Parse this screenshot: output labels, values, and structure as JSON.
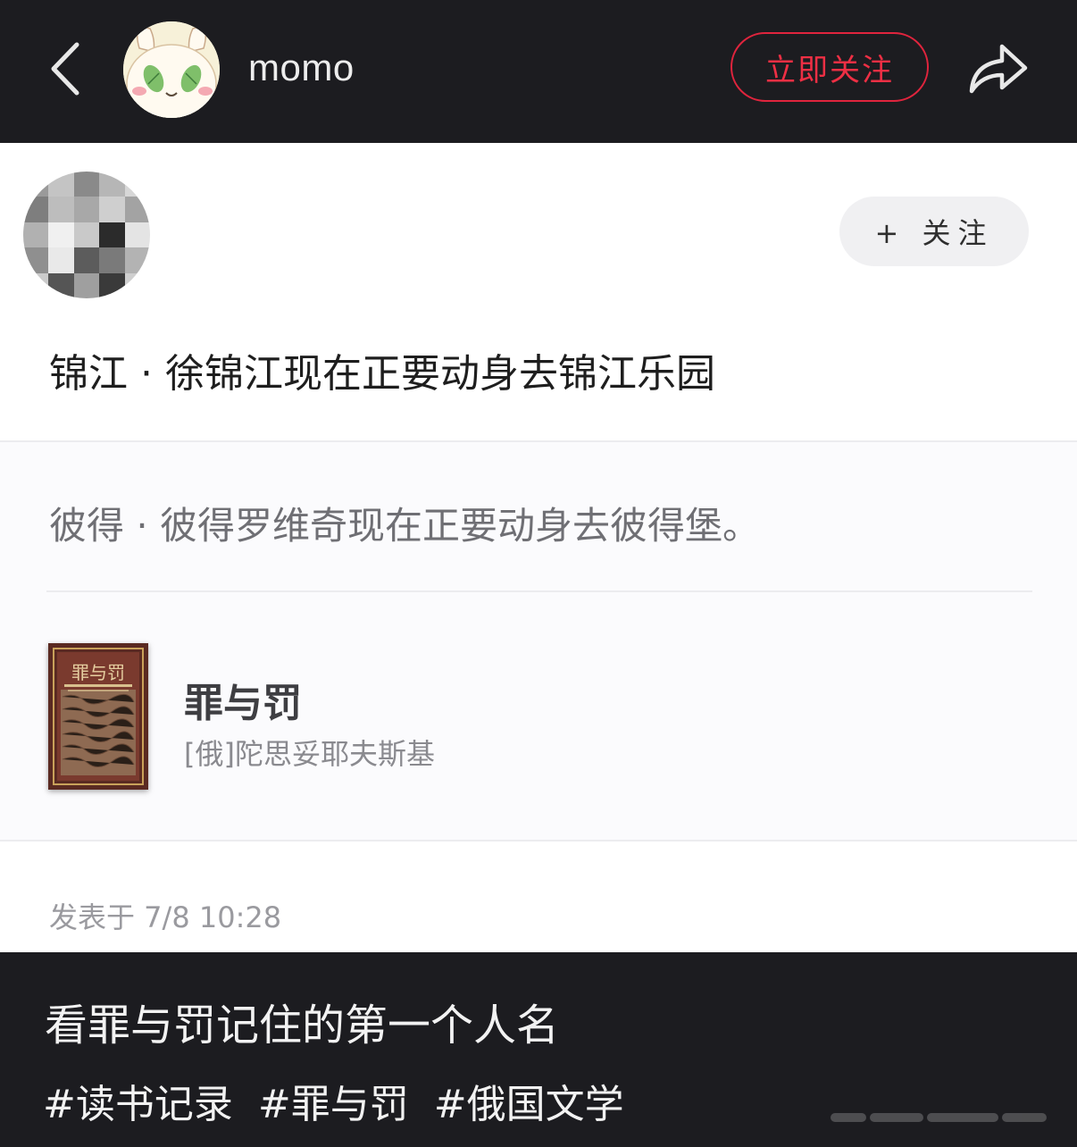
{
  "header": {
    "username": "momo",
    "follow_now_label": "立即关注"
  },
  "post": {
    "follow_label": "+ 关注",
    "title": "锦江 · 徐锦江现在正要动身去锦江乐园",
    "quote": "彼得 · 彼得罗维奇现在正要动身去彼得堡。",
    "book": {
      "title": "罪与罚",
      "author": "[俄]陀思妥耶夫斯基",
      "cover_title": "罪与罚"
    },
    "published": "发表于 7/8 10:28"
  },
  "caption": {
    "text": "看罪与罚记住的第一个人名",
    "tags": [
      "#读书记录",
      "#罪与罚",
      "#俄国文学"
    ]
  },
  "colors": {
    "background_dark": "#1c1c20",
    "accent_red": "#e0243d",
    "card_bg": "#ffffff"
  }
}
